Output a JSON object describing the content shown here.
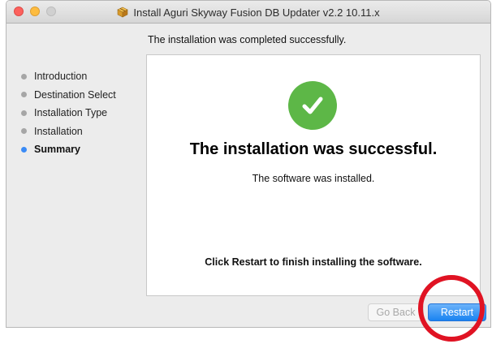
{
  "window": {
    "title": "Install Aguri Skyway Fusion DB Updater v2.2 10.11.x",
    "title_icon": "package-icon",
    "subtitle": "The installation was completed successfully."
  },
  "sidebar": {
    "steps": [
      {
        "label": "Introduction",
        "active": false
      },
      {
        "label": "Destination Select",
        "active": false
      },
      {
        "label": "Installation Type",
        "active": false
      },
      {
        "label": "Installation",
        "active": false
      },
      {
        "label": "Summary",
        "active": true
      }
    ]
  },
  "content": {
    "icon": "checkmark-icon",
    "headline": "The installation was successful.",
    "message": "The software was installed.",
    "instruction": "Click Restart to finish installing the software."
  },
  "buttons": {
    "go_back": "Go Back",
    "restart": "Restart"
  },
  "colors": {
    "success_green": "#5db747",
    "active_bullet": "#3b8bf6",
    "inactive_bullet": "#a6a6a6",
    "primary_button": "#1a83f1",
    "annotation_circle": "#e01323"
  }
}
